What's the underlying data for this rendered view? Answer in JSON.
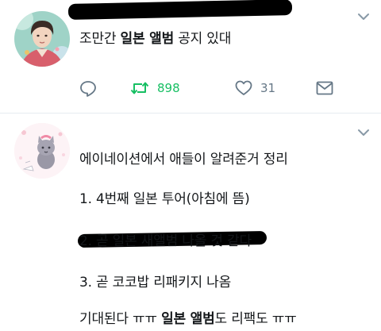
{
  "tweet1": {
    "text_pre": "조만간 ",
    "text_bold": "일본 앨범",
    "text_post": " 공지 있대",
    "retweets": "898",
    "likes": "31"
  },
  "tweet2": {
    "lines": [
      "에이네이션에서 애들이 알려준거 정리",
      "1. 4번째 일본 투어(아침에 뜸)",
      "2. 곧 일본 새앨범 나올 것 같다",
      "3. 곧 코코밥 리패키지 나옴"
    ],
    "last_pre": "기대된다 ㅠㅠ ",
    "last_bold": "일본 앨범",
    "last_post": "도 리팩도 ㅠㅠ"
  },
  "colors": {
    "retweet_green": "#17bf63",
    "icon_gray": "#657786",
    "divider": "#e6ecf0"
  },
  "icons": [
    "chevron-down-icon",
    "reply-icon",
    "retweet-icon",
    "heart-icon",
    "message-icon"
  ]
}
